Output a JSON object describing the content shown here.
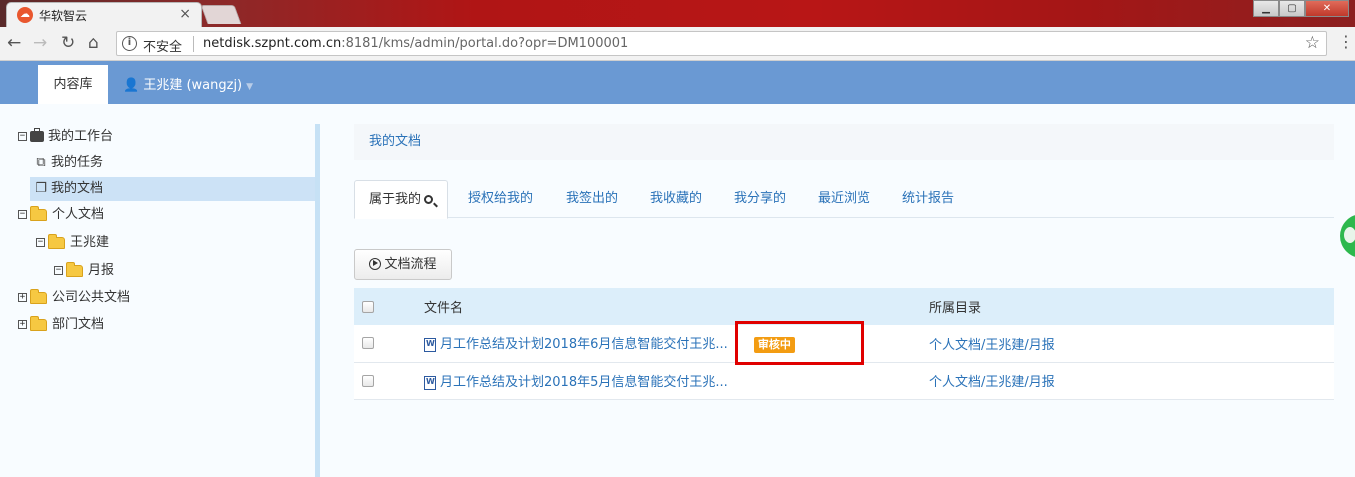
{
  "browser": {
    "tab_title": "华软智云",
    "tab_favicon": "cloud-icon",
    "security_label": "不安全",
    "url_host": "netdisk.szpnt.com.cn",
    "url_rest": ":8181/kms/admin/portal.do?opr=DM100001"
  },
  "appbar": {
    "content_tab": "内容库",
    "user_name": "王兆建 (wangzj)",
    "user_icon": "user-icon"
  },
  "sidebar": {
    "items": [
      {
        "label": "我的工作台"
      },
      {
        "label": "我的任务"
      },
      {
        "label": "我的文档"
      },
      {
        "label": "个人文档"
      },
      {
        "label": "王兆建"
      },
      {
        "label": "月报"
      },
      {
        "label": "公司公共文档"
      },
      {
        "label": "部门文档"
      }
    ]
  },
  "main": {
    "breadcrumb": "我的文档",
    "tabs": [
      "属于我的",
      "授权给我的",
      "我签出的",
      "我收藏的",
      "我分享的",
      "最近浏览",
      "统计报告"
    ],
    "flow_button": "文档流程",
    "table": {
      "headers": [
        "文件名",
        "所属目录"
      ],
      "rows": [
        {
          "name": "月工作总结及计划2018年6月信息智能交付王兆...",
          "status": "审核中",
          "folder": "个人文档/王兆建/月报"
        },
        {
          "name": "月工作总结及计划2018年5月信息智能交付王兆...",
          "status": "",
          "folder": "个人文档/王兆建/月报"
        }
      ]
    }
  },
  "colors": {
    "appbar": "#6a99d3",
    "link": "#2a72b8",
    "badge": "#f39c12",
    "highlight": "#e00000"
  }
}
